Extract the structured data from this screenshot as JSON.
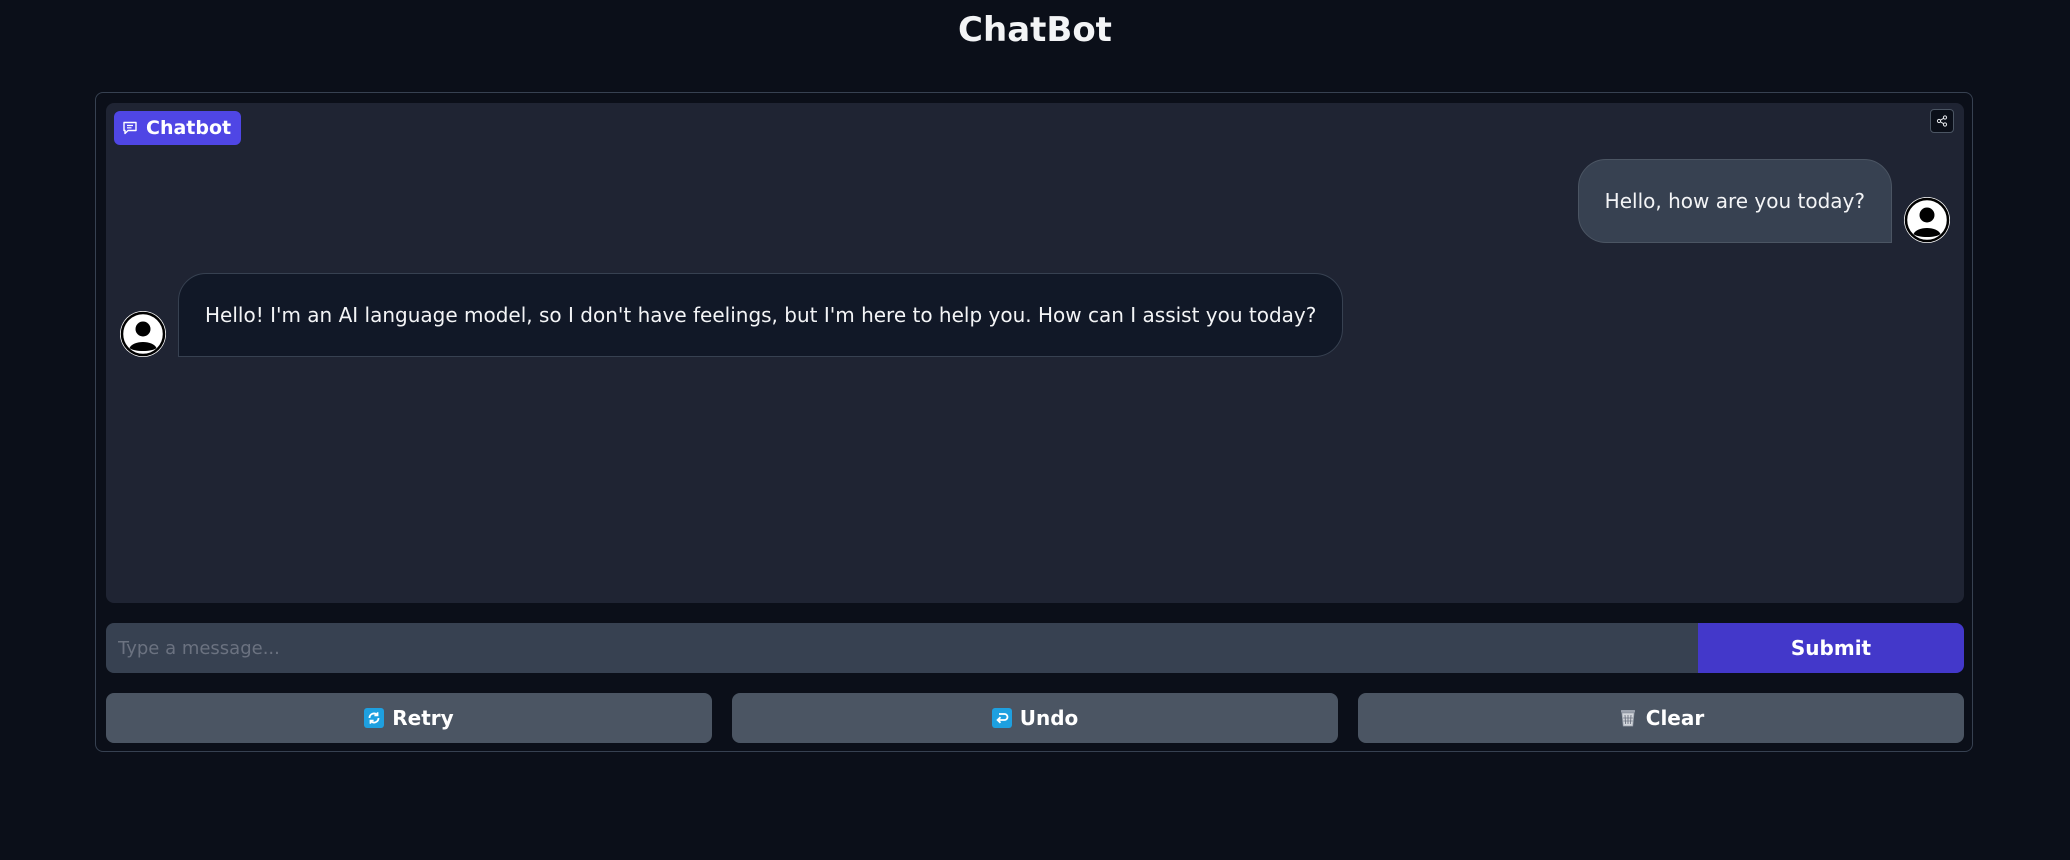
{
  "page": {
    "title": "ChatBot"
  },
  "chatbot": {
    "label": "Chatbot",
    "label_icon": "chat-bubble-icon",
    "share_icon": "share-icon",
    "messages": [
      {
        "role": "user",
        "text": "Hello, how are you today?"
      },
      {
        "role": "bot",
        "text": "Hello! I'm an AI language model, so I don't have feelings, but I'm here to help you. How can I assist you today?"
      }
    ]
  },
  "input": {
    "placeholder": "Type a message...",
    "value": ""
  },
  "submit": {
    "label": "Submit"
  },
  "actions": {
    "retry": {
      "label": "Retry",
      "icon": "retry-icon"
    },
    "undo": {
      "label": "Undo",
      "icon": "undo-icon"
    },
    "clear": {
      "label": "Clear",
      "icon": "wastebasket-icon"
    }
  },
  "colors": {
    "background": "#0b0f19",
    "panel": "#1f2433",
    "accent": "#4f46e5",
    "submit": "#4338ca",
    "button": "#4b5563"
  }
}
